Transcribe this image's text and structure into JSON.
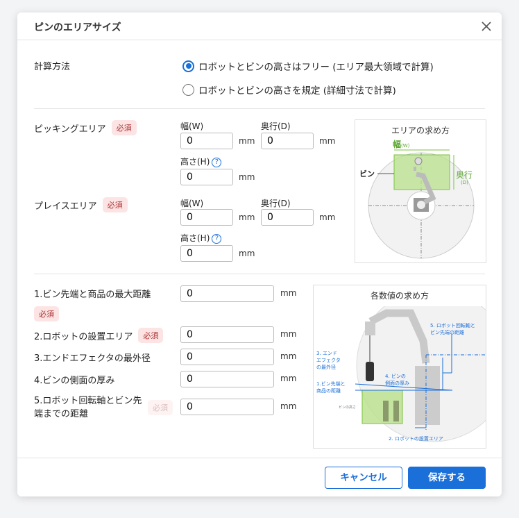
{
  "dialog": {
    "title": "ピンのエリアサイズ"
  },
  "calc": {
    "label": "計算方法",
    "options": [
      {
        "label": "ロボットとビンの高さはフリー (エリア最大領域で計算)",
        "selected": true
      },
      {
        "label": "ロボットとビンの高さを規定 (詳細寸法で計算)",
        "selected": false
      }
    ]
  },
  "required": "必須",
  "unit": "mm",
  "picking": {
    "label": "ピッキングエリア",
    "width_label": "幅(W)",
    "depth_label": "奥行(D)",
    "height_label": "高さ(H)",
    "width": "0",
    "depth": "0",
    "height": "0"
  },
  "place": {
    "label": "プレイスエリア",
    "width_label": "幅(W)",
    "depth_label": "奥行(D)",
    "height_label": "高さ(H)",
    "width": "0",
    "depth": "0",
    "height": "0"
  },
  "area_diagram": {
    "title": "エリアの求め方",
    "width": "幅",
    "width_sub": "(W)",
    "depth": "奥行",
    "depth_sub": "(D)",
    "bin": "ビン"
  },
  "params": [
    {
      "label": "1.ビン先端と商品の最大距離",
      "value": "0"
    },
    {
      "label": "2.ロボットの設置エリア",
      "value": "0"
    },
    {
      "label": "3.エンドエフェクタの最外径",
      "value": "0"
    },
    {
      "label": "4.ビンの側面の厚み",
      "value": "0"
    },
    {
      "label": "5.ロボット回転軸とビン先端までの距離",
      "value": "0"
    }
  ],
  "value_diagram": {
    "title": "各数値の求め方",
    "l1": "1.ビン先端と",
    "l1b": "商品の距離",
    "l2": "2. ロボットの設置エリア",
    "l3": "3. エンド",
    "l3b": "エフェクタ",
    "l3c": "の最外径",
    "l4": "4. ビンの",
    "l4b": "側面の厚み",
    "l5": "5. ロボット回転軸と",
    "l5b": "ビン先端の距離",
    "bin_height": "ビンの高さ"
  },
  "footer": {
    "cancel": "キャンセル",
    "save": "保存する"
  }
}
